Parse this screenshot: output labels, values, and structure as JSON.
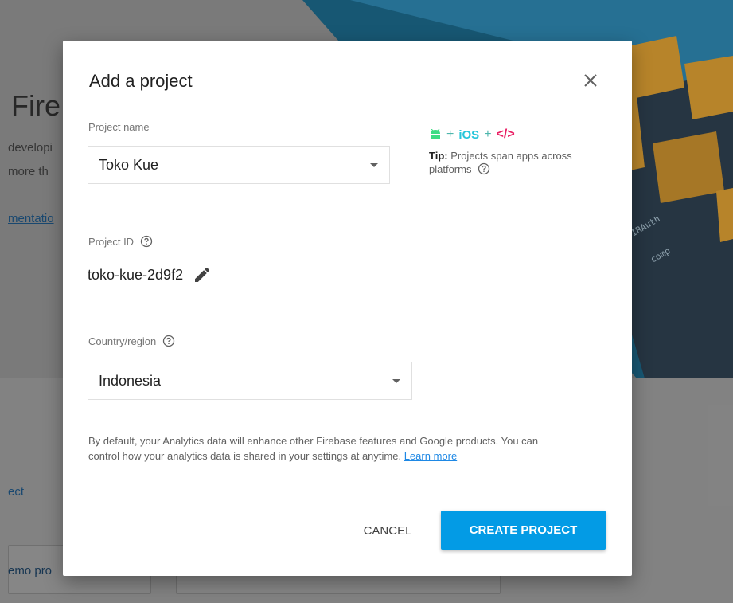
{
  "background": {
    "title_fragment": "Fire",
    "line1_fragment": "developi",
    "line2_fragment": "more th",
    "link_fragment": "mentatio",
    "card_label_fragment": "ect",
    "card_text_fragment": "emo pro"
  },
  "modal": {
    "title": "Add a project",
    "project_name_label": "Project name",
    "project_name_value": "Toko Kue",
    "project_id_label": "Project ID",
    "project_id_value": "toko-kue-2d9f2",
    "country_label": "Country/region",
    "country_value": "Indonesia",
    "tip": {
      "ios_label": "iOS",
      "code_label": "</>",
      "plus": "+",
      "tip_bold": "Tip:",
      "tip_text": " Projects span apps across platforms"
    },
    "analytics_text": "By default, your Analytics data will enhance other Firebase features and Google products. You can control how your analytics data is shared in your settings at anytime. ",
    "learn_more": "Learn more",
    "cancel_label": "CANCEL",
    "create_label": "CREATE PROJECT"
  },
  "colors": {
    "primary": "#039be5",
    "android": "#3ddc84",
    "ios": "#26c6da",
    "code": "#e91e63"
  }
}
